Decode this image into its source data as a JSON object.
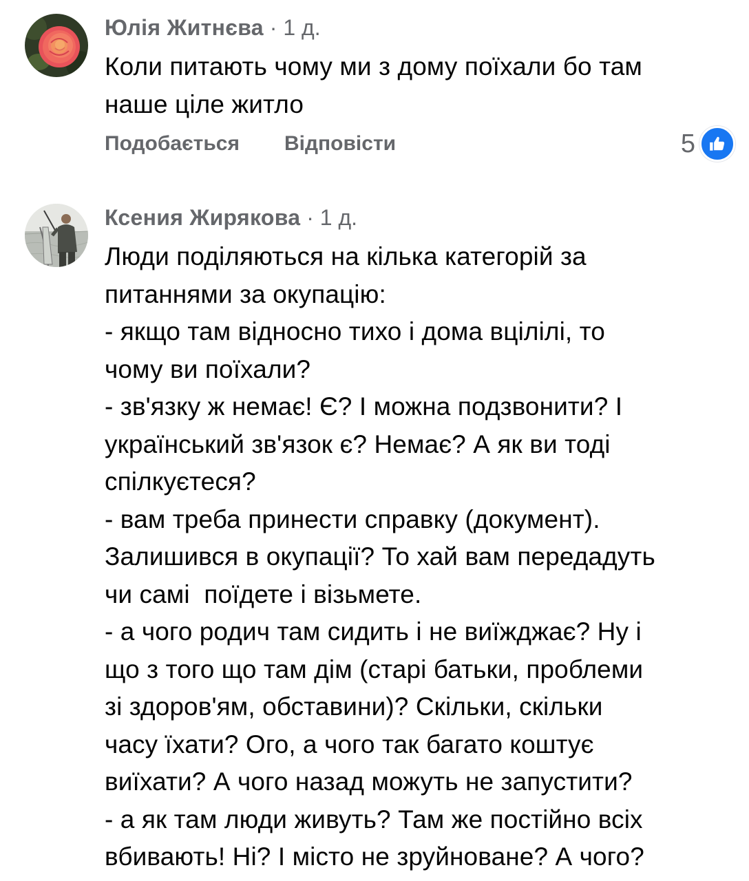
{
  "comments": [
    {
      "author": "Юлія Житнєва",
      "separator": "·",
      "time": "1 д.",
      "lines": [
        "Коли питають чому ми з дому поїхали бо там",
        "наше ціле житло"
      ],
      "actions": {
        "like_label": "Подобається",
        "reply_label": "Відповісти"
      },
      "reaction_count": "5",
      "reaction_icon": "like-icon",
      "avatar_icon": "rose-photo"
    },
    {
      "author": "Ксения Жирякова",
      "separator": "·",
      "time": "1 д.",
      "lines": [
        "Люди поділяються на кілька категорій за",
        "питаннями за окупацію:",
        "- якщо там відносно тихо і дома вцілілі, то",
        "чому ви поїхали?",
        "- зв'язку ж немає! Є? І можна подзвонити? І",
        "український зв'язок є? Немає? А як ви тоді",
        "спілкуєтеся?",
        "- вам треба принести справку (документ).",
        "Залишився в окупації? То хай вам передадуть",
        "чи самі  поїдете і візьмете.",
        "- а чого родич там сидить і не виїжджає? Ну і",
        "що з того що там дім (старі батьки, проблеми",
        "зі здоров'ям, обставини)? Скільки, скільки",
        "часу їхати? Ого, а чого так багато коштує",
        "виїхати? А чого назад можуть не запустити?",
        "- а як там люди живуть? Там же постійно всіх",
        "вбивають! Ні? І місто не зруйноване? А чого?"
      ],
      "avatar_icon": "fisherman-photo"
    }
  ],
  "colors": {
    "meta_gray": "#65676b",
    "text": "#050505",
    "like_blue": "#1877f2"
  }
}
